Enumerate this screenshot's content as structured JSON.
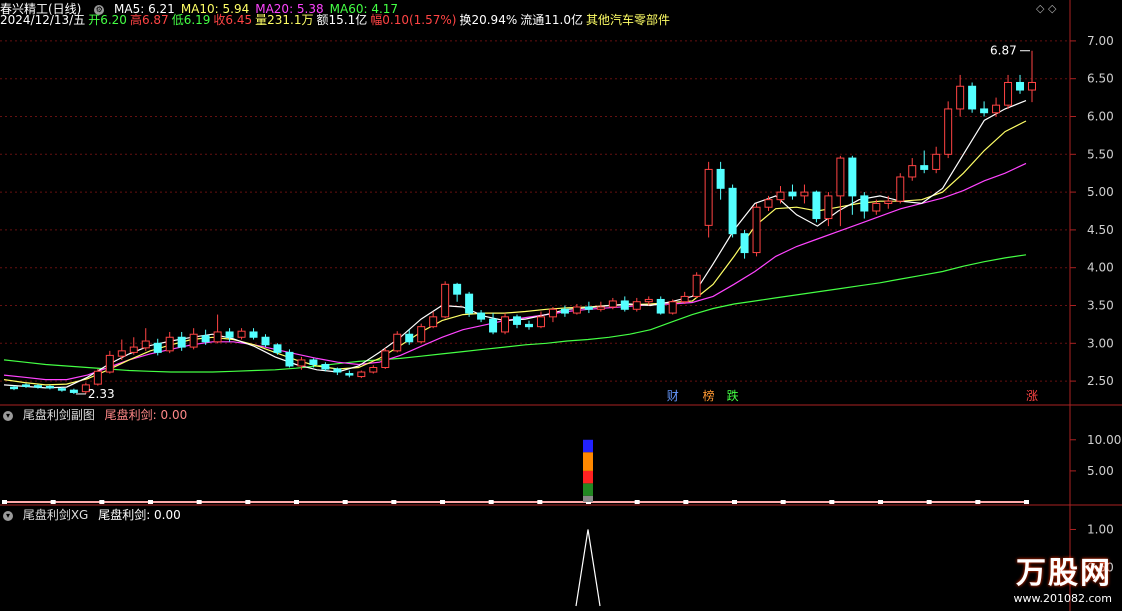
{
  "main": {
    "name": "春兴精工(日线)",
    "ma": [
      {
        "label": "MA5: 6.21",
        "color": "#ffffff"
      },
      {
        "label": "MA10: 5.94",
        "color": "#ffff66"
      },
      {
        "label": "MA20: 5.38",
        "color": "#ff44ff"
      },
      {
        "label": "MA60: 4.17",
        "color": "#44ff44"
      }
    ],
    "info": [
      {
        "text": "2024/12/13/五",
        "color": "#ffffff"
      },
      {
        "text": "开6.20",
        "color": "#44ff44"
      },
      {
        "text": "高6.87",
        "color": "#ff4444"
      },
      {
        "text": "低6.19",
        "color": "#44ff44"
      },
      {
        "text": "收6.45",
        "color": "#ff4444"
      },
      {
        "text": "量231.1万",
        "color": "#ffff66"
      },
      {
        "text": "额15.1亿",
        "color": "#ffffff"
      },
      {
        "text": "幅0.10(1.57%)",
        "color": "#ff4444"
      },
      {
        "text": "换20.94%",
        "color": "#ffffff"
      },
      {
        "text": "流通11.0亿",
        "color": "#ffffff"
      },
      {
        "text": "其他汽车零部件",
        "color": "#ffff66"
      }
    ],
    "y_ticks": [
      "7.00",
      "6.50",
      "6.00",
      "5.50",
      "5.00",
      "4.50",
      "4.00",
      "3.50",
      "3.00",
      "2.50"
    ],
    "high_label": "6.87",
    "low_label": "2.33",
    "markers": [
      {
        "text": "财",
        "color": "#6699ff"
      },
      {
        "text": "榜",
        "color": "#ff9933"
      },
      {
        "text": "跌",
        "color": "#44ff44"
      },
      {
        "text": "涨",
        "color": "#ff4444"
      }
    ]
  },
  "pane2": {
    "title": "尾盘利剑副图",
    "value_label": "尾盘利剑: 0.00",
    "y_ticks": [
      "10.00",
      "5.00"
    ]
  },
  "pane3": {
    "title": "尾盘利剑XG",
    "value_label": "尾盘利剑: 0.00",
    "y_ticks": [
      "1.00",
      "0.50"
    ]
  },
  "watermark": {
    "brand": "万股网",
    "url": "www.201082.com"
  },
  "chart_data": [
    {
      "type": "candlestick",
      "title": "春兴精工(日线)",
      "ylim": [
        2.25,
        7.25
      ],
      "candles": [
        [
          2.42,
          2.4,
          2.44,
          2.38
        ],
        [
          2.45,
          2.43,
          2.47,
          2.41
        ],
        [
          2.44,
          2.42,
          2.46,
          2.4
        ],
        [
          2.43,
          2.41,
          2.45,
          2.39
        ],
        [
          2.4,
          2.38,
          2.42,
          2.36
        ],
        [
          2.38,
          2.35,
          2.4,
          2.33
        ],
        [
          2.36,
          2.45,
          2.48,
          2.33
        ],
        [
          2.46,
          2.63,
          2.66,
          2.44
        ],
        [
          2.62,
          2.84,
          2.9,
          2.6
        ],
        [
          2.83,
          2.9,
          3.05,
          2.78
        ],
        [
          2.88,
          2.95,
          3.08,
          2.85
        ],
        [
          2.94,
          3.03,
          3.2,
          2.9
        ],
        [
          3.0,
          2.88,
          3.06,
          2.84
        ],
        [
          2.9,
          3.08,
          3.15,
          2.87
        ],
        [
          3.08,
          2.95,
          3.15,
          2.9
        ],
        [
          2.95,
          3.12,
          3.2,
          2.92
        ],
        [
          3.1,
          3.02,
          3.18,
          2.98
        ],
        [
          3.02,
          3.15,
          3.38,
          3.0
        ],
        [
          3.15,
          3.08,
          3.2,
          3.02
        ],
        [
          3.08,
          3.16,
          3.2,
          3.05
        ],
        [
          3.15,
          3.08,
          3.2,
          3.05
        ],
        [
          3.08,
          2.98,
          3.12,
          2.95
        ],
        [
          2.98,
          2.88,
          3.0,
          2.85
        ],
        [
          2.88,
          2.7,
          2.92,
          2.68
        ],
        [
          2.7,
          2.78,
          2.82,
          2.65
        ],
        [
          2.78,
          2.72,
          2.8,
          2.68
        ],
        [
          2.72,
          2.66,
          2.75,
          2.63
        ],
        [
          2.66,
          2.62,
          2.68,
          2.58
        ],
        [
          2.6,
          2.58,
          2.64,
          2.55
        ],
        [
          2.56,
          2.62,
          2.64,
          2.54
        ],
        [
          2.62,
          2.68,
          2.71,
          2.6
        ],
        [
          2.68,
          2.9,
          2.94,
          2.66
        ],
        [
          2.9,
          3.12,
          3.16,
          2.88
        ],
        [
          3.12,
          3.02,
          3.18,
          2.98
        ],
        [
          3.02,
          3.22,
          3.26,
          3.0
        ],
        [
          3.22,
          3.35,
          3.42,
          3.2
        ],
        [
          3.35,
          3.78,
          3.82,
          3.33
        ],
        [
          3.78,
          3.65,
          3.8,
          3.55
        ],
        [
          3.65,
          3.4,
          3.68,
          3.35
        ],
        [
          3.4,
          3.32,
          3.44,
          3.28
        ],
        [
          3.32,
          3.15,
          3.4,
          3.12
        ],
        [
          3.15,
          3.35,
          3.4,
          3.12
        ],
        [
          3.35,
          3.25,
          3.38,
          3.2
        ],
        [
          3.25,
          3.22,
          3.3,
          3.18
        ],
        [
          3.22,
          3.35,
          3.42,
          3.2
        ],
        [
          3.35,
          3.45,
          3.48,
          3.28
        ],
        [
          3.45,
          3.4,
          3.5,
          3.35
        ],
        [
          3.4,
          3.48,
          3.52,
          3.38
        ],
        [
          3.48,
          3.45,
          3.55,
          3.4
        ],
        [
          3.45,
          3.48,
          3.55,
          3.42
        ],
        [
          3.48,
          3.56,
          3.6,
          3.45
        ],
        [
          3.56,
          3.45,
          3.62,
          3.42
        ],
        [
          3.45,
          3.55,
          3.6,
          3.42
        ],
        [
          3.55,
          3.58,
          3.62,
          3.5
        ],
        [
          3.58,
          3.4,
          3.62,
          3.38
        ],
        [
          3.4,
          3.55,
          3.58,
          3.38
        ],
        [
          3.55,
          3.62,
          3.68,
          3.52
        ],
        [
          3.62,
          3.9,
          3.94,
          3.6
        ],
        [
          4.56,
          5.3,
          5.4,
          4.4
        ],
        [
          5.3,
          5.05,
          5.4,
          4.9
        ],
        [
          5.05,
          4.45,
          5.1,
          4.4
        ],
        [
          4.45,
          4.2,
          4.5,
          4.12
        ],
        [
          4.2,
          4.8,
          4.85,
          4.15
        ],
        [
          4.8,
          4.9,
          4.95,
          4.75
        ],
        [
          4.9,
          5.0,
          5.08,
          4.85
        ],
        [
          5.0,
          4.95,
          5.1,
          4.9
        ],
        [
          4.95,
          5.0,
          5.1,
          4.85
        ],
        [
          5.0,
          4.65,
          5.02,
          4.6
        ],
        [
          4.65,
          4.95,
          5.0,
          4.55
        ],
        [
          4.95,
          5.45,
          5.48,
          4.55
        ],
        [
          5.45,
          4.95,
          5.48,
          4.7
        ],
        [
          4.95,
          4.75,
          5.0,
          4.65
        ],
        [
          4.75,
          4.85,
          4.9,
          4.7
        ],
        [
          4.85,
          4.88,
          4.95,
          4.78
        ],
        [
          4.88,
          5.2,
          5.25,
          4.85
        ],
        [
          5.2,
          5.35,
          5.45,
          5.15
        ],
        [
          5.35,
          5.3,
          5.55,
          5.25
        ],
        [
          5.3,
          5.5,
          5.6,
          5.25
        ],
        [
          5.5,
          6.1,
          6.2,
          5.45
        ],
        [
          6.1,
          6.4,
          6.55,
          6.0
        ],
        [
          6.4,
          6.1,
          6.45,
          6.05
        ],
        [
          6.1,
          6.05,
          6.2,
          6.0
        ],
        [
          6.05,
          6.15,
          6.25,
          6.0
        ],
        [
          6.15,
          6.45,
          6.55,
          6.1
        ],
        [
          6.45,
          6.35,
          6.55,
          6.3
        ],
        [
          6.35,
          6.45,
          6.87,
          6.19
        ]
      ],
      "ma5": [
        2.45,
        2.43,
        2.41,
        2.42,
        2.55,
        2.72,
        2.86,
        2.97,
        3.03,
        3.08,
        3.12,
        3.06,
        2.96,
        2.82,
        2.72,
        2.65,
        2.62,
        2.7,
        2.88,
        3.08,
        3.32,
        3.5,
        3.48,
        3.36,
        3.3,
        3.32,
        3.38,
        3.45,
        3.47,
        3.5,
        3.52,
        3.5,
        3.55,
        3.62,
        4.05,
        4.5,
        4.85,
        4.95,
        4.7,
        4.55,
        4.75,
        4.9,
        4.95,
        4.88,
        4.85,
        5.05,
        5.5,
        5.95,
        6.1,
        6.21
      ],
      "ma10": [
        2.52,
        2.48,
        2.45,
        2.46,
        2.53,
        2.65,
        2.78,
        2.9,
        2.98,
        3.05,
        3.08,
        3.05,
        2.98,
        2.88,
        2.78,
        2.7,
        2.66,
        2.68,
        2.8,
        2.97,
        3.15,
        3.3,
        3.38,
        3.4,
        3.4,
        3.42,
        3.45,
        3.47,
        3.48,
        3.5,
        3.51,
        3.52,
        3.54,
        3.56,
        3.78,
        4.15,
        4.55,
        4.78,
        4.8,
        4.75,
        4.8,
        4.85,
        4.88,
        4.88,
        4.9,
        5.0,
        5.25,
        5.55,
        5.8,
        5.94
      ],
      "ma20": [
        2.58,
        2.55,
        2.52,
        2.52,
        2.58,
        2.68,
        2.78,
        2.86,
        2.92,
        2.98,
        3.02,
        3.02,
        2.98,
        2.92,
        2.86,
        2.8,
        2.75,
        2.72,
        2.75,
        2.84,
        2.96,
        3.08,
        3.18,
        3.24,
        3.3,
        3.34,
        3.38,
        3.42,
        3.45,
        3.47,
        3.49,
        3.51,
        3.52,
        3.54,
        3.62,
        3.78,
        3.95,
        4.15,
        4.28,
        4.38,
        4.48,
        4.58,
        4.68,
        4.78,
        4.85,
        4.92,
        5.02,
        5.15,
        5.25,
        5.38
      ],
      "ma60": [
        2.78,
        2.75,
        2.72,
        2.7,
        2.68,
        2.66,
        2.64,
        2.63,
        2.62,
        2.62,
        2.62,
        2.63,
        2.64,
        2.65,
        2.67,
        2.7,
        2.73,
        2.76,
        2.78,
        2.8,
        2.83,
        2.86,
        2.89,
        2.92,
        2.95,
        2.98,
        3.0,
        3.03,
        3.05,
        3.08,
        3.12,
        3.18,
        3.28,
        3.38,
        3.46,
        3.52,
        3.56,
        3.6,
        3.64,
        3.68,
        3.72,
        3.76,
        3.8,
        3.85,
        3.9,
        3.95,
        4.02,
        4.08,
        4.13,
        4.17
      ]
    },
    {
      "type": "bar",
      "title": "尾盘利剑副图",
      "ylim": [
        0,
        13.5
      ],
      "stack_at_index": 28,
      "segments": [
        {
          "color": "#888888",
          "value": 1.0
        },
        {
          "color": "#228822",
          "value": 2.0
        },
        {
          "color": "#ff2222",
          "value": 2.0
        },
        {
          "color": "#ff8800",
          "value": 3.0
        },
        {
          "color": "#2222ff",
          "value": 2.0
        }
      ],
      "baseline": 0
    },
    {
      "type": "line",
      "title": "尾盘利剑XG",
      "ylim": [
        0,
        1.15
      ],
      "spike_at_index": 28,
      "spike_value": 1.0
    }
  ]
}
